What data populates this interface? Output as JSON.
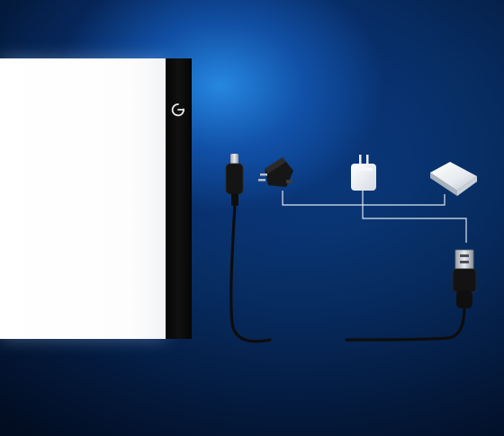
{
  "scene": {
    "description_hint": "",
    "icons": {
      "power_button": "power-icon",
      "usb_c_plug": "usb-c-plug-icon",
      "wall_adapter": "wall-adapter-icon",
      "usb_charger": "usb-charger-icon",
      "power_bank": "power-bank-icon",
      "usb_a_plug": "usb-a-plug-icon"
    },
    "colors": {
      "background_glow": "#2a8ee6",
      "background_dark": "#020d22",
      "pad_surface": "#ffffff",
      "pad_border": "#0a0a0a",
      "cable": "#111111",
      "connector_line": "#dfe6ee"
    }
  }
}
